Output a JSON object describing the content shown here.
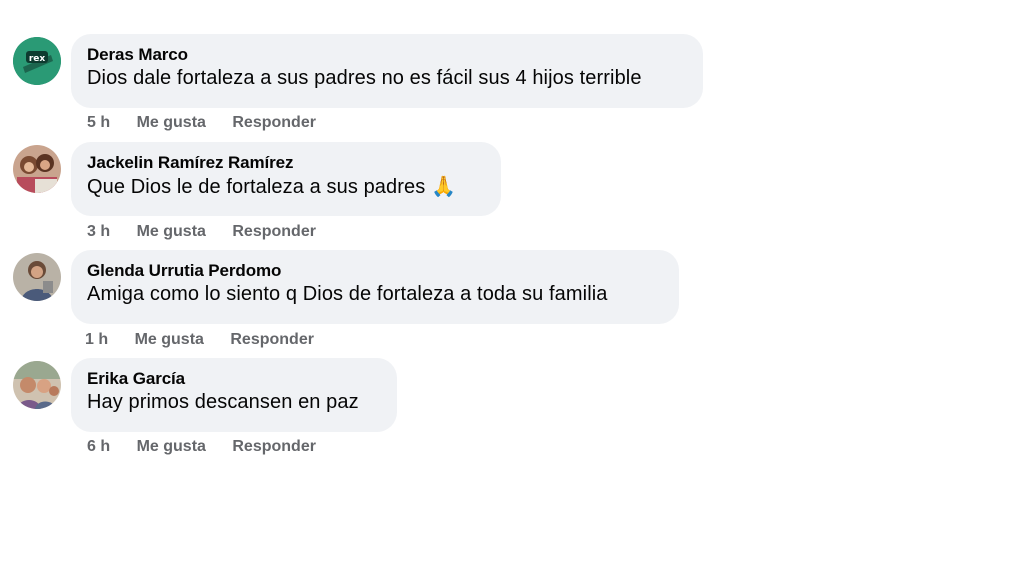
{
  "comments": [
    {
      "author": "Deras Marco",
      "text": "Dios dale fortaleza a sus padres no es fácil sus 4 hijos terrible",
      "emoji": "",
      "time": "5 h",
      "like_label": "Me gusta",
      "reply_label": "Responder",
      "avatar_badge": "rex"
    },
    {
      "author": "Jackelin Ramírez Ramírez",
      "text": "Que Dios le de fortaleza a sus padres",
      "emoji": "🙏",
      "time": "3 h",
      "like_label": "Me gusta",
      "reply_label": "Responder"
    },
    {
      "author": "Glenda Urrutia Perdomo",
      "text": "Amiga como lo siento q Dios de fortaleza a toda su familia",
      "emoji": "",
      "time": "1 h",
      "like_label": "Me gusta",
      "reply_label": "Responder"
    },
    {
      "author": "Erika García",
      "text": "Hay primos descansen en paz",
      "emoji": "",
      "time": "6 h",
      "like_label": "Me gusta",
      "reply_label": "Responder"
    }
  ],
  "colors": {
    "bubble_bg": "#f0f2f5",
    "action_text": "#65676b",
    "text": "#050505"
  }
}
